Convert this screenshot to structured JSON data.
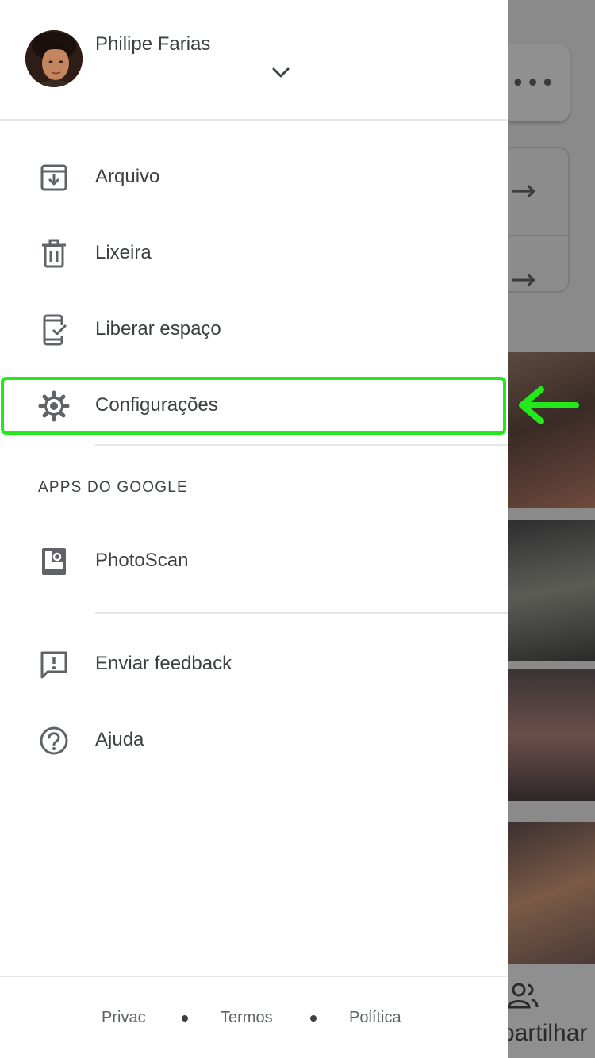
{
  "account": {
    "name": "Philipe Farias"
  },
  "menu": {
    "items": [
      {
        "label": "Arquivo",
        "icon": "archive-icon"
      },
      {
        "label": "Lixeira",
        "icon": "trash-icon"
      },
      {
        "label": "Liberar espaço",
        "icon": "phone-check-icon"
      },
      {
        "label": "Configurações",
        "icon": "gear-icon"
      }
    ]
  },
  "google_apps": {
    "header": "APPS DO GOOGLE",
    "items": [
      {
        "label": "PhotoScan",
        "icon": "photoscan-icon"
      }
    ]
  },
  "support": {
    "items": [
      {
        "label": "Enviar feedback",
        "icon": "feedback-icon"
      },
      {
        "label": "Ajuda",
        "icon": "help-icon"
      }
    ]
  },
  "footer": {
    "links": [
      "Privac",
      "Termos",
      "Política"
    ]
  },
  "background": {
    "share_label": "partilhar"
  },
  "colors": {
    "highlight": "#22e81c",
    "text": "#3c4043",
    "divider": "#e6e6e6"
  }
}
